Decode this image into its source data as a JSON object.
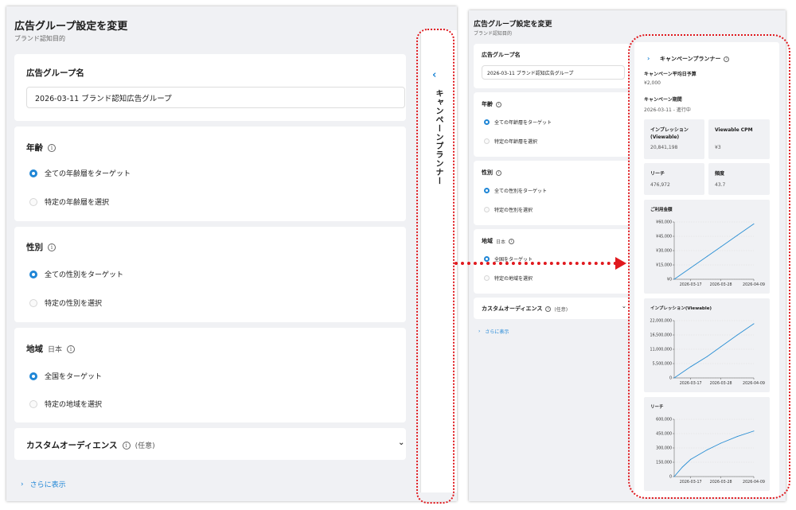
{
  "header": {
    "title": "広告グループ設定を変更",
    "subtitle": "ブランド認知目的"
  },
  "ad_group_name": {
    "label": "広告グループ名",
    "value": "2026-03-11 ブランド認知広告グループ"
  },
  "age": {
    "label": "年齢",
    "options": [
      "全ての年齢層をターゲット",
      "特定の年齢層を選択"
    ],
    "selected_index": 0
  },
  "gender": {
    "label": "性別",
    "options": [
      "全ての性別をターゲット",
      "特定の性別を選択"
    ],
    "selected_index": 0
  },
  "region": {
    "label": "地域",
    "sublabel": "日本",
    "options": [
      "全国をターゲット",
      "特定の地域を選択"
    ],
    "selected_index": 0
  },
  "custom_audience": {
    "label": "カスタムオーディエンス",
    "optional": "(任意)"
  },
  "show_more": {
    "label": "さらに表示"
  },
  "planner": {
    "title": "キャンペーンプランナー",
    "daily_budget_label": "キャンペーン平均日予算",
    "daily_budget_value": "¥2,000",
    "period_label": "キャンペーン期間",
    "period_value": "2026-03-11 - 進行中",
    "metrics": {
      "impressions": {
        "label_line1": "インプレッション",
        "label_line2": "(Viewable)",
        "value": "20,841,198"
      },
      "cpm": {
        "label": "Viewable CPM",
        "value": "¥3"
      },
      "reach": {
        "label": "リーチ",
        "value": "476,972"
      },
      "frequency": {
        "label": "頻度",
        "value": "43.7"
      }
    }
  },
  "chart_data": [
    {
      "type": "line",
      "title": "ご利用金額",
      "x": [
        "2026-03-11",
        "2026-03-17",
        "2026-03-23",
        "2026-03-28",
        "2026-04-03",
        "2026-04-09"
      ],
      "values": [
        0,
        12000,
        24000,
        34000,
        46000,
        58000
      ],
      "ylim": [
        0,
        60000
      ],
      "y_ticks": [
        "¥60,000",
        "¥45,000",
        "¥30,000",
        "¥15,000",
        "¥0"
      ],
      "x_ticks": [
        "2026-03-17",
        "2026-03-28",
        "2026-04-09"
      ],
      "color": "#2a8fd4"
    },
    {
      "type": "line",
      "title": "インプレッション(Viewable)",
      "x": [
        "2026-03-11",
        "2026-03-17",
        "2026-03-23",
        "2026-03-28",
        "2026-04-03",
        "2026-04-09"
      ],
      "values": [
        0,
        4300000,
        8200000,
        12000000,
        16500000,
        20800000
      ],
      "ylim": [
        0,
        22000000
      ],
      "y_ticks": [
        "22,000,000",
        "16,500,000",
        "11,000,000",
        "5,500,000",
        "0"
      ],
      "x_ticks": [
        "2026-03-17",
        "2026-03-28",
        "2026-04-09"
      ],
      "color": "#2a8fd4"
    },
    {
      "type": "line",
      "title": "リーチ",
      "x": [
        "2026-03-11",
        "2026-03-14",
        "2026-03-17",
        "2026-03-23",
        "2026-03-28",
        "2026-04-03",
        "2026-04-09"
      ],
      "values": [
        0,
        100000,
        180000,
        280000,
        350000,
        420000,
        477000
      ],
      "ylim": [
        0,
        600000
      ],
      "y_ticks": [
        "600,000",
        "450,000",
        "300,000",
        "150,000",
        "0"
      ],
      "x_ticks": [
        "2026-03-17",
        "2026-03-28",
        "2026-04-09"
      ],
      "color": "#2a8fd4"
    }
  ]
}
